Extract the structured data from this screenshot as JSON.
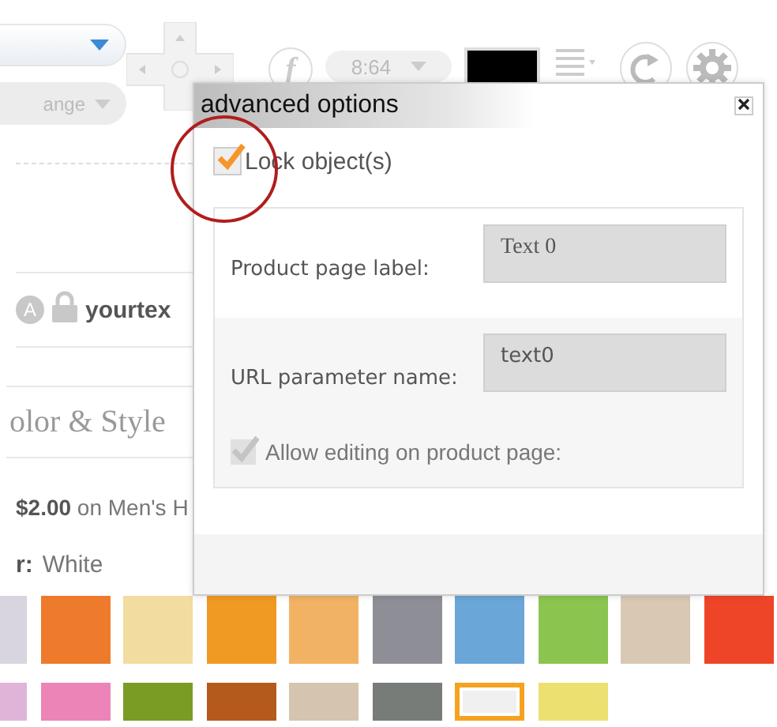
{
  "toolbar": {
    "style_dropdown": {
      "value": "ange"
    },
    "font_button": "f",
    "size_dropdown": {
      "value": "8:64"
    }
  },
  "layers": [
    {
      "badge": "A",
      "locked": true,
      "name": "yourtex"
    }
  ],
  "section_title": "olor & Style",
  "price_note": "**$2.00** on Men's H",
  "color_label": {
    "label": "r:",
    "value": "White"
  },
  "swatches": [
    {
      "color": "#d8d4e0",
      "selected": false
    },
    {
      "color": "#ee7a2c",
      "selected": false
    },
    {
      "color": "#f2dca0",
      "selected": false
    },
    {
      "color": "#f09a24",
      "selected": false
    },
    {
      "color": "#f2b264",
      "selected": false
    },
    {
      "color": "#8e8e96",
      "selected": false
    },
    {
      "color": "#6aa6d8",
      "selected": false
    },
    {
      "color": "#8cc450",
      "selected": false
    },
    {
      "color": "#d8c8b4",
      "selected": false
    },
    {
      "color": "#ee4428",
      "selected": false
    },
    {
      "color": "#e0b4d8",
      "selected": false
    },
    {
      "color": "#ec84b8",
      "selected": false
    },
    {
      "color": "#7a9c24",
      "selected": false
    },
    {
      "color": "#b45a1c",
      "selected": false
    },
    {
      "color": "#d4c4b0",
      "selected": false
    },
    {
      "color": "#787c78",
      "selected": false
    },
    {
      "color": "#f0f0f0",
      "selected": true
    },
    {
      "color": "#ece070",
      "selected": false
    }
  ],
  "dialog": {
    "title": "advanced options",
    "lock": {
      "label": "Lock object(s)",
      "checked": true
    },
    "fields": [
      {
        "label": "Product page label:",
        "value": "Text 0"
      },
      {
        "label": "URL parameter name:",
        "value": "text0"
      }
    ],
    "allow_editing": {
      "label": "Allow editing on product page:",
      "checked": true,
      "disabled": true
    }
  }
}
